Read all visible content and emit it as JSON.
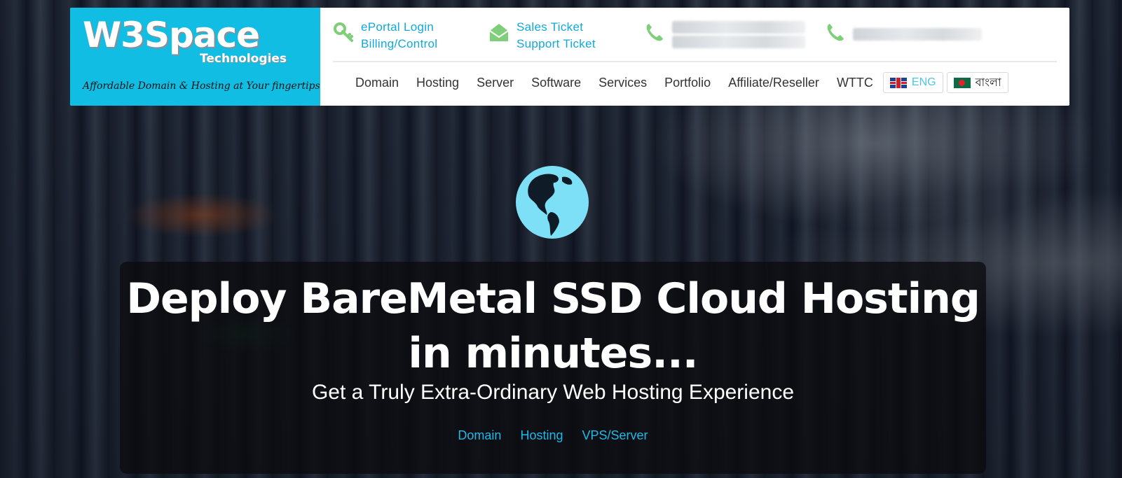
{
  "brand": {
    "logo_main": "W3Space",
    "logo_sub": "Technologies",
    "tagline": "Affordable Domain & Hosting at Your fingertips"
  },
  "contacts": {
    "portal": {
      "line1": "ePortal Login",
      "line2": "Billing/Control",
      "icon": "key-icon"
    },
    "tickets": {
      "line1": "Sales Ticket",
      "line2": "Support Ticket",
      "icon": "envelope-icon"
    },
    "phone1": {
      "icon": "phone-icon",
      "text_visible": "(\n(",
      "blurred": true
    },
    "phone2": {
      "icon": "phone-icon",
      "blurred": true
    }
  },
  "nav": {
    "items": [
      "Domain",
      "Hosting",
      "Server",
      "Software",
      "Services",
      "Portfolio",
      "Affiliate/Reseller",
      "WTTC"
    ],
    "lang_eng": "ENG",
    "lang_bn": "বাংলা"
  },
  "hero": {
    "title_line1": "Deploy BareMetal SSD Cloud Hosting",
    "title_line2": "in minutes...",
    "subtitle": "Get a Truly Extra-Ordinary Web Hosting Experience",
    "links": [
      "Domain",
      "Hosting",
      "VPS/Server"
    ]
  },
  "colors": {
    "brand_cyan": "#11bde3",
    "link_blue": "#11a9dc",
    "icon_green": "#7fcf7a",
    "globe": "#7ee0f7"
  }
}
